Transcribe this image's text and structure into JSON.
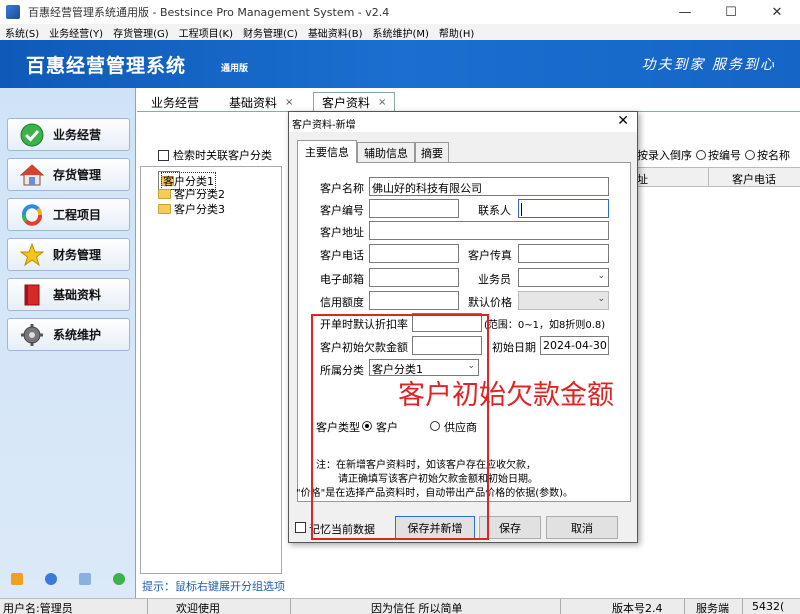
{
  "window": {
    "title": "百惠经营管理系统通用版 - Bestsince Pro Management System - v2.4",
    "minimize": "—",
    "maximize": "☐",
    "close": "✕"
  },
  "menu": [
    "系统(S)",
    "业务经营(Y)",
    "存货管理(G)",
    "工程项目(K)",
    "财务管理(C)",
    "基础资料(B)",
    "系统维护(M)",
    "帮助(H)"
  ],
  "banner": {
    "title": "百惠经营管理系统",
    "edition": "通用版",
    "slogan": "功夫到家  服务到心"
  },
  "nav": [
    {
      "label": "业务经营",
      "icon": "check-icon"
    },
    {
      "label": "存货管理",
      "icon": "house-icon"
    },
    {
      "label": "工程项目",
      "icon": "cycle-icon"
    },
    {
      "label": "财务管理",
      "icon": "star-icon"
    },
    {
      "label": "基础资料",
      "icon": "book-icon"
    },
    {
      "label": "系统维护",
      "icon": "gear-icon"
    }
  ],
  "tabs": [
    {
      "label": "业务经营",
      "closable": false
    },
    {
      "label": "基础资料",
      "closable": true
    },
    {
      "label": "客户资料",
      "closable": true,
      "active": true
    }
  ],
  "tab_close": "×",
  "main": {
    "search_link_checkbox": "检索时关联客户分类",
    "tree": [
      "客户分类1",
      "客户分类2",
      "客户分类3"
    ],
    "sort_prefix": "按录入倒序",
    "sort_by_number": "按编号",
    "sort_by_name": "按名称",
    "grid_headers": [
      "址",
      "客户电话"
    ],
    "hint": "提示：鼠标右键展开分组选项"
  },
  "status": {
    "user": "用户名:管理员",
    "welcome": "欢迎使用",
    "motto": "因为信任 所以简单",
    "version": "版本号2.4",
    "server": "服务端",
    "port": "5432("
  },
  "dialog": {
    "title": "客户资料-新增",
    "close": "✕",
    "tabs": [
      "主要信息",
      "辅助信息",
      "摘要"
    ],
    "fields": {
      "name_label": "客户名称",
      "name_value": "佛山好的科技有限公司",
      "code_label": "客户编号",
      "contact_label": "联系人",
      "address_label": "客户地址",
      "phone_label": "客户电话",
      "fax_label": "客户传真",
      "email_label": "电子邮箱",
      "salesman_label": "业务员",
      "credit_label": "信用额度",
      "default_price_label": "默认价格",
      "discount_label": "开单时默认折扣率",
      "discount_hint": "(范围：0~1，如8折则0.8)",
      "initial_debt_label": "客户初始欠款金额",
      "initial_date_label": "初始日期",
      "initial_date_value": "2024-04-30",
      "category_label": "所属分类",
      "category_value": "客户分类1",
      "type_label": "客户类型",
      "type_customer": "客户",
      "type_supplier": "供应商"
    },
    "note_line1": "注：在新增客户资料时，如该客户存在应收欠款，",
    "note_line2": "请正确填写该客户初始欠款金额和初始日期。",
    "note_line3": "\"价格\"是在选择产品资料时，自动带出产品价格的依据(参数)。",
    "remember_label": "记忆当前数据",
    "btn_save_new": "保存并新增",
    "btn_save": "保存",
    "btn_cancel": "取消"
  },
  "annotation": {
    "text": "客户初始欠款金额",
    "color": "#e02424"
  }
}
